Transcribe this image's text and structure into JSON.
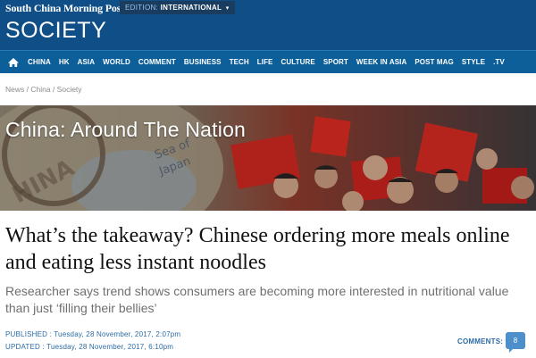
{
  "masthead": {
    "brand": "South China Morning Post",
    "edition_label": "EDITION:",
    "edition_value": "INTERNATIONAL",
    "section_title": "SOCIETY"
  },
  "nav": {
    "items": [
      "CHINA",
      "HK",
      "ASIA",
      "WORLD",
      "COMMENT",
      "BUSINESS",
      "TECH",
      "LIFE",
      "CULTURE",
      "SPORT",
      "WEEK IN ASIA",
      "POST MAG",
      "STYLE",
      ".TV"
    ]
  },
  "breadcrumb": {
    "items": [
      "News",
      "China",
      "Society"
    ],
    "separator": " / "
  },
  "banner": {
    "title": "China: Around The Nation"
  },
  "article": {
    "headline": "What’s the takeaway? Chinese ordering more meals online and eating less instant noodles",
    "subhead": "Researcher says trend shows consumers are becoming more interested in nutritional value than just ‘filling their bellies’",
    "published": "PUBLISHED : Tuesday, 28 November, 2017, 2:07pm",
    "updated": "UPDATED : Tuesday, 28 November, 2017, 6:10pm",
    "comments_label": "COMMENTS:",
    "comments_count": "8"
  },
  "colors": {
    "masthead": "#0f4e86",
    "navbar": "#0d5f99",
    "link": "#2b6ba5",
    "badge": "#4d8fca"
  }
}
